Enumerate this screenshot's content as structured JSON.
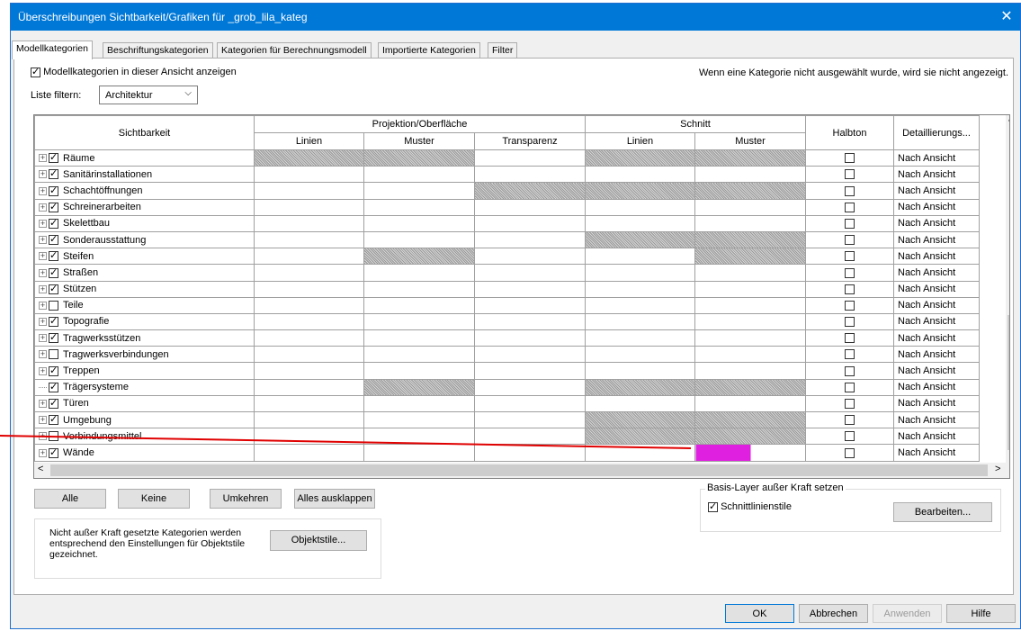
{
  "dialog": {
    "title": "Überschreibungen Sichtbarkeit/Grafiken für _grob_lila_kateg",
    "close_glyph": "✕"
  },
  "tabs": [
    {
      "label": "Modellkategorien",
      "active": true
    },
    {
      "label": "Beschriftungskategorien"
    },
    {
      "label": "Kategorien für Berechnungsmodell"
    },
    {
      "label": "Importierte Kategorien"
    },
    {
      "label": "Filter"
    }
  ],
  "model_panel": {
    "show_checkbox_label": "Modellkategorien in dieser Ansicht anzeigen",
    "show_checked": true,
    "hint": "Wenn eine Kategorie nicht ausgewählt wurde, wird sie nicht angezeigt.",
    "filter_label": "Liste filtern:",
    "filter_value": "Architektur"
  },
  "grid": {
    "headers": {
      "visibility": "Sichtbarkeit",
      "projection": "Projektion/Oberfläche",
      "cut": "Schnitt",
      "halftone": "Halbton",
      "detail": "Detaillierungs...",
      "lines": "Linien",
      "pattern": "Muster",
      "transparency": "Transparenz",
      "cut_lines": "Linien",
      "cut_pattern": "Muster"
    },
    "rows": [
      {
        "name": "Räume",
        "checked": true,
        "expander": "plus",
        "detail": "Nach Ansicht",
        "cells": [
          "hatch",
          "hatch",
          "",
          "hatch",
          "hatch"
        ]
      },
      {
        "name": "Sanitärinstallationen",
        "checked": true,
        "expander": "plus",
        "detail": "Nach Ansicht",
        "cells": [
          "",
          "",
          "",
          "",
          ""
        ]
      },
      {
        "name": "Schachtöffnungen",
        "checked": true,
        "expander": "plus",
        "detail": "Nach Ansicht",
        "cells": [
          "",
          "",
          "hatch",
          "hatch",
          "hatch"
        ]
      },
      {
        "name": "Schreinerarbeiten",
        "checked": true,
        "expander": "plus",
        "detail": "Nach Ansicht",
        "cells": [
          "",
          "",
          "",
          "",
          ""
        ]
      },
      {
        "name": "Skelettbau",
        "checked": true,
        "expander": "plus",
        "detail": "Nach Ansicht",
        "cells": [
          "",
          "",
          "",
          "",
          ""
        ]
      },
      {
        "name": "Sonderausstattung",
        "checked": true,
        "expander": "plus",
        "detail": "Nach Ansicht",
        "cells": [
          "",
          "",
          "",
          "hatch",
          "hatch"
        ]
      },
      {
        "name": "Steifen",
        "checked": true,
        "expander": "plus",
        "detail": "Nach Ansicht",
        "cells": [
          "",
          "hatch",
          "",
          "",
          "hatch"
        ]
      },
      {
        "name": "Straßen",
        "checked": true,
        "expander": "plus",
        "detail": "Nach Ansicht",
        "cells": [
          "",
          "",
          "",
          "",
          ""
        ]
      },
      {
        "name": "Stützen",
        "checked": true,
        "expander": "plus",
        "detail": "Nach Ansicht",
        "cells": [
          "",
          "",
          "",
          "",
          ""
        ]
      },
      {
        "name": "Teile",
        "checked": false,
        "expander": "plus",
        "detail": "Nach Ansicht",
        "cells": [
          "",
          "",
          "",
          "",
          ""
        ]
      },
      {
        "name": "Topografie",
        "checked": true,
        "expander": "plus",
        "detail": "Nach Ansicht",
        "cells": [
          "",
          "",
          "",
          "",
          ""
        ]
      },
      {
        "name": "Tragwerksstützen",
        "checked": true,
        "expander": "plus",
        "detail": "Nach Ansicht",
        "cells": [
          "",
          "",
          "",
          "",
          ""
        ]
      },
      {
        "name": "Tragwerksverbindungen",
        "checked": false,
        "expander": "plus",
        "detail": "Nach Ansicht",
        "cells": [
          "",
          "",
          "",
          "",
          ""
        ]
      },
      {
        "name": "Treppen",
        "checked": true,
        "expander": "plus",
        "detail": "Nach Ansicht",
        "cells": [
          "",
          "",
          "",
          "",
          ""
        ]
      },
      {
        "name": "Trägersysteme",
        "checked": true,
        "expander": "dash",
        "detail": "Nach Ansicht",
        "cells": [
          "",
          "hatch",
          "",
          "hatch",
          "hatch"
        ]
      },
      {
        "name": "Türen",
        "checked": true,
        "expander": "plus",
        "detail": "Nach Ansicht",
        "cells": [
          "",
          "",
          "",
          "",
          ""
        ]
      },
      {
        "name": "Umgebung",
        "checked": true,
        "expander": "plus",
        "detail": "Nach Ansicht",
        "cells": [
          "",
          "",
          "",
          "hatch",
          "hatch"
        ]
      },
      {
        "name": "Verbindungsmittel",
        "checked": false,
        "expander": "plus",
        "detail": "Nach Ansicht",
        "cells": [
          "",
          "",
          "",
          "hatch",
          "hatch"
        ]
      },
      {
        "name": "Wände",
        "checked": true,
        "expander": "plus",
        "detail": "Nach Ansicht",
        "cells": [
          "",
          "",
          "",
          "",
          "magenta"
        ]
      }
    ]
  },
  "buttons": {
    "all": "Alle",
    "none": "Keine",
    "invert": "Umkehren",
    "expand_all": "Alles ausklappen",
    "object_styles": "Objektstile...",
    "edit": "Bearbeiten...",
    "ok": "OK",
    "cancel": "Abbrechen",
    "apply": "Anwenden",
    "help": "Hilfe"
  },
  "info_text": "Nicht außer Kraft gesetzte Kategorien werden entsprechend den Einstellungen für Objektstile gezeichnet.",
  "base_layer": {
    "legend": "Basis-Layer außer Kraft setzen",
    "checkbox_label": "Schnittlinienstile",
    "checked": true
  },
  "colors": {
    "titlebar": "#0078d7",
    "highlight_magenta": "#e020e0",
    "arrow_red": "#e00000"
  }
}
